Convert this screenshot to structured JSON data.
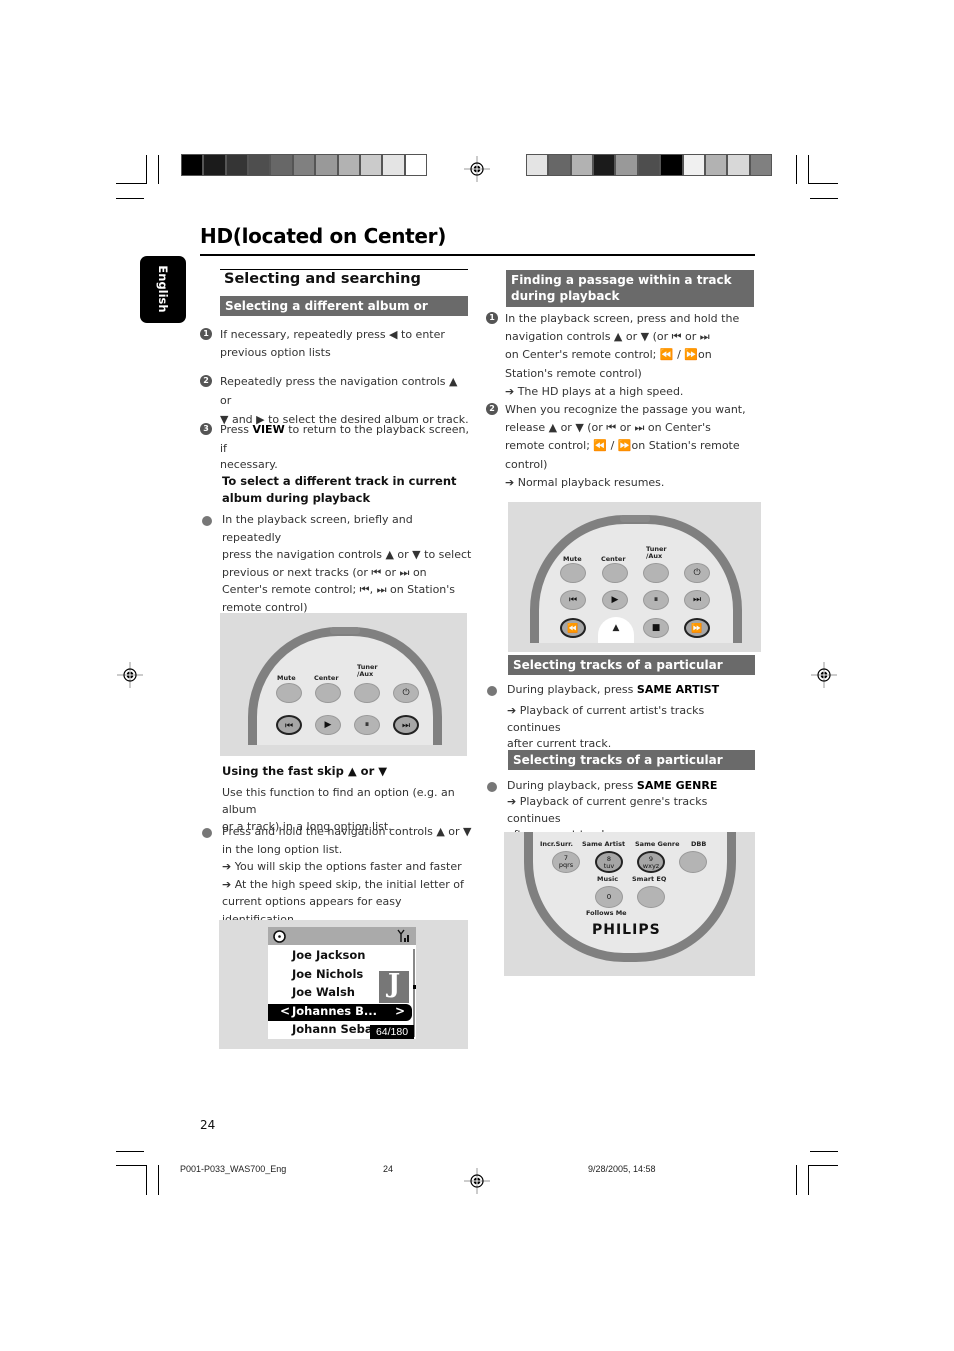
{
  "page": {
    "title": "HD(located on Center)",
    "language_tab": "English",
    "page_number": "24"
  },
  "colorbars": {
    "left": [
      "#000000",
      "#1b1b1b",
      "#353535",
      "#4e4e4e",
      "#676767",
      "#808080",
      "#999999",
      "#b2b2b2",
      "#cbcbcb",
      "#e4e4e4",
      "#ffffff"
    ],
    "right": [
      "#e4e4e4",
      "#676767",
      "#b2b2b2",
      "#1b1b1b",
      "#999999",
      "#4e4e4e",
      "#000000",
      "#f0f0f0",
      "#b2b2b2",
      "#d8d8d8",
      "#808080"
    ]
  },
  "left": {
    "section_title": "Selecting and searching",
    "band1": "Selecting a different album or track",
    "steps": [
      {
        "num": "1",
        "line1": "If necessary, repeatedly press ◀  to enter",
        "line2": "previous option lists"
      },
      {
        "num": "2",
        "line1": "Repeatedly press the navigation controls  ▲  or",
        "line2": "▼  and ▶  to select the desired album or track."
      },
      {
        "num": "3",
        "line1_pre": "Press ",
        "line1_bold": "VIEW",
        "line1_post": "  to return to the playback screen, if",
        "line2": "necessary."
      }
    ],
    "subhead1_line1": "To select a different track in current",
    "subhead1_line2": "album during playback",
    "bullet1": [
      "In the playback screen, briefly and repeatedly",
      "press the navigation controls  ▲  or   ▼ to select",
      "previous or next tracks (or ⏮  or ⏭ on",
      "Center's remote control;  ⏮,  ⏭  on Station's",
      "remote control)"
    ],
    "subhead2": "Using the fast skip  ▲  or  ▼",
    "subhead2_intro": [
      "Use this function to find an option (e.g. an album",
      "or a track) in a long option list."
    ],
    "bullet2": [
      "Press and hold the navigation controls  ▲  or  ▼",
      "in the long option list.",
      "➔ You will skip the options faster and faster",
      "➔  At the high speed skip, the initial letter of",
      "current options appears for easy identification"
    ]
  },
  "remote1": {
    "labels": {
      "mute": "Mute",
      "center": "Center",
      "tuner": "Tuner /Aux"
    },
    "row2": [
      "⏮",
      "▶",
      "⏸",
      "⏭"
    ],
    "power": "⏻"
  },
  "lcd": {
    "items": [
      "Joe  Jackson",
      "Joe  Nichols",
      "Joe  Walsh",
      "Johannes  B...",
      "Johann  Seba.."
    ],
    "selected_index": 3,
    "letter": "J",
    "counter": "64/180",
    "left_arrow": "<",
    "right_arrow": ">"
  },
  "right": {
    "band1_line1": "Finding a passage within a track",
    "band1_line2": "during playback",
    "steps1": [
      "In the playback screen, press and hold the",
      "navigation controls  ▲  or   ▼ (or ⏮  or ⏭",
      "on Center's remote control;  ⏪ /    ⏩on",
      "Station's remote control)",
      "➔ The HD plays at a high speed."
    ],
    "steps2": [
      "When you recognize the passage you want,",
      "release ▲  or ▼ (or ⏮  or ⏭ on Center's",
      "remote control;  ⏪ /    ⏩on Station's remote",
      "control)",
      "➔ Normal playback resumes."
    ],
    "band2": "Selecting tracks of a particular artist",
    "artist_pre": "During playback, press ",
    "artist_bold": "SAME ARTIST",
    "artist_result": [
      "➔ Playback of current artist's tracks continues",
      "after current track."
    ],
    "band3": "Selecting tracks of a particular genre",
    "genre_pre": "During playback, press ",
    "genre_bold": "SAME GENRE",
    "genre_result": [
      "➔ Playback of current genre's tracks continues",
      "after current track."
    ]
  },
  "remote2": {
    "labels": {
      "mute": "Mute",
      "center": "Center",
      "tuner": "Tuner /Aux"
    },
    "row2": [
      "⏮",
      "▶",
      "⏸",
      "⏭"
    ],
    "row3": [
      "⏪",
      "▲",
      "■",
      "⏩"
    ],
    "power": "⏻"
  },
  "remote3": {
    "labels": [
      "Incr.Surr.",
      "Same Artist",
      "Same Genre",
      "DBB"
    ],
    "keys": [
      "7\npqrs",
      "8\ntuv",
      "9\nwxyz",
      ""
    ],
    "music": "Music",
    "smart_eq": "Smart EQ",
    "zero": "0",
    "follows_me": "Follows Me",
    "brand": "PHILIPS"
  },
  "footer": {
    "file": "P001-P033_WAS700_Eng",
    "page": "24",
    "date": "9/28/2005, 14:58"
  }
}
